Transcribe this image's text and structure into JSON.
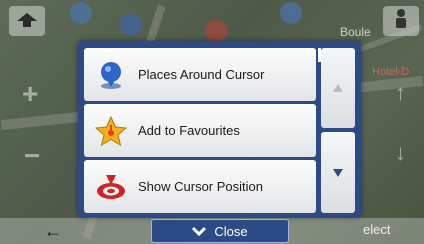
{
  "map": {
    "street_label": "Boule",
    "poi_label": "Hotel-D"
  },
  "menu": {
    "items": [
      {
        "label": "Places Around Cursor",
        "icon": "pin-icon"
      },
      {
        "label": "Add to Favourites",
        "icon": "star-icon"
      },
      {
        "label": "Show Cursor Position",
        "icon": "cursor-target-icon"
      }
    ],
    "close_label": "Close"
  },
  "bottombar": {
    "select_label": "elect"
  },
  "colors": {
    "dialog_bg": "#2c4a86",
    "item_bg": "#f4f5f6",
    "star": "#f2b01c",
    "pin": "#2b66c8",
    "target": "#d12323"
  }
}
